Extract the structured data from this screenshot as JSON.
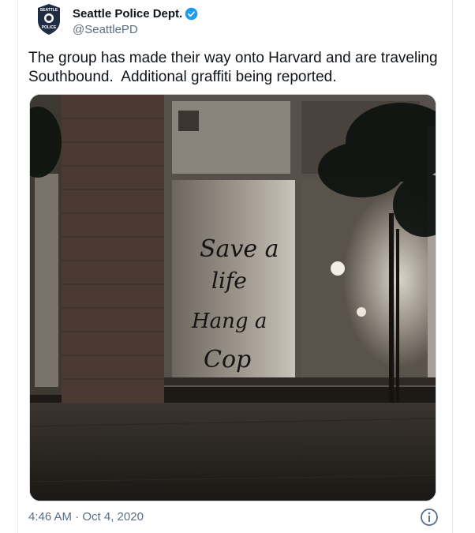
{
  "tweet": {
    "display_name": "Seattle Police Dept.",
    "handle": "@SeattlePD",
    "text": "The group has made their way onto Harvard and are traveling\nSouthbound.  Additional graffiti being reported.",
    "timestamp": "4:46 AM · Oct 4, 2020",
    "avatar_badge": {
      "top": "SEATTLE",
      "bottom": "POLICE"
    },
    "image_graffiti": [
      "Save a",
      "life",
      "Hang a",
      "Cop"
    ]
  },
  "colors": {
    "verified": "#1d9bf0",
    "muted": "#5b7083",
    "badge": "#1f2d44"
  },
  "icons": [
    "verified-badge-icon",
    "info-icon"
  ]
}
